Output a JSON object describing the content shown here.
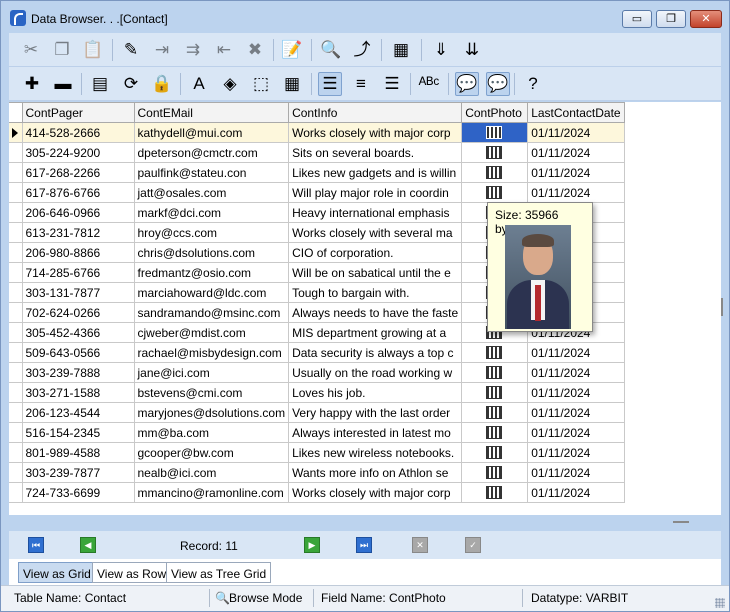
{
  "window": {
    "title": "Data Browser. . .[Contact]",
    "minimize_glyph": "▭",
    "restore_glyph": "❐",
    "close_glyph": "✕"
  },
  "toolbar_row1": [
    {
      "icon": "cut-icon",
      "glyph": "✂",
      "enabled": false
    },
    {
      "icon": "copy-icon",
      "glyph": "❐",
      "enabled": false
    },
    {
      "icon": "paste-icon",
      "glyph": "📋",
      "enabled": false
    },
    {
      "icon": "edit-pencil-icon",
      "glyph": "✎",
      "enabled": true
    },
    {
      "icon": "insert-row-icon",
      "glyph": "⇥",
      "enabled": false
    },
    {
      "icon": "append-row-icon",
      "glyph": "⇉",
      "enabled": false
    },
    {
      "icon": "delete-row-icon",
      "glyph": "⇤",
      "enabled": false
    },
    {
      "icon": "delete-x-icon",
      "glyph": "✖",
      "enabled": false
    },
    {
      "icon": "edit-document-icon",
      "glyph": "📝",
      "enabled": true
    },
    {
      "icon": "find-icon",
      "glyph": "🔍",
      "enabled": true
    },
    {
      "icon": "find-next-icon",
      "glyph": "⤴",
      "enabled": true
    },
    {
      "icon": "filter-icon",
      "glyph": "▦",
      "enabled": true
    },
    {
      "icon": "sort-ascending-icon",
      "glyph": "⇓",
      "enabled": true
    },
    {
      "icon": "sort-descending-icon",
      "glyph": "⇊",
      "enabled": true
    }
  ],
  "toolbar_row2": [
    {
      "icon": "add-record-icon",
      "glyph": "✚",
      "enabled": true
    },
    {
      "icon": "delete-record-icon",
      "glyph": "▬",
      "enabled": true
    },
    {
      "icon": "layout-icon",
      "glyph": "▤",
      "enabled": true
    },
    {
      "icon": "refresh-icon",
      "glyph": "⟳",
      "enabled": true
    },
    {
      "icon": "lock-icon",
      "glyph": "🔒",
      "enabled": true
    },
    {
      "icon": "font-icon",
      "glyph": "A",
      "enabled": true
    },
    {
      "icon": "fill-color-icon",
      "glyph": "◈",
      "enabled": true
    },
    {
      "icon": "fit-columns-icon",
      "glyph": "⬚",
      "enabled": true
    },
    {
      "icon": "grid-lines-icon",
      "glyph": "▦",
      "enabled": true
    },
    {
      "icon": "align-left-icon",
      "glyph": "☰",
      "enabled": true,
      "pressed": true
    },
    {
      "icon": "align-center-icon",
      "glyph": "≡",
      "enabled": true
    },
    {
      "icon": "align-right-icon",
      "glyph": "☰",
      "enabled": true
    },
    {
      "icon": "spell-check-icon",
      "glyph": "ᴬᴮᶜ",
      "enabled": true
    },
    {
      "icon": "show-memo-tips-icon",
      "glyph": "💬",
      "enabled": true,
      "pressed": true
    },
    {
      "icon": "show-image-tips-icon",
      "glyph": "💬",
      "enabled": true,
      "pressed": true
    },
    {
      "icon": "help-icon",
      "glyph": "?",
      "enabled": true
    }
  ],
  "grid": {
    "columns": [
      "ContPager",
      "ContEMail",
      "ContInfo",
      "ContPhoto",
      "LastContactDate"
    ],
    "rows": [
      {
        "pager": "414-528-2666",
        "email": "kathydell@mui.com",
        "info": "Works closely with major corp",
        "date": "01/11/2024",
        "current": true
      },
      {
        "pager": "305-224-9200",
        "email": "dpeterson@cmctr.com",
        "info": "Sits on several boards.",
        "date": "01/11/2024"
      },
      {
        "pager": "617-268-2266",
        "email": "paulfink@stateu.con",
        "info": "Likes new gadgets and is willin",
        "date": "01/11/2024"
      },
      {
        "pager": "617-876-6766",
        "email": "jatt@osales.com",
        "info": "Will play major role in coordin",
        "date": "01/11/2024"
      },
      {
        "pager": "206-646-0966",
        "email": "markf@dci.com",
        "info": "Heavy international emphasis",
        "date": "01/11/2024"
      },
      {
        "pager": "613-231-7812",
        "email": "hroy@ccs.com",
        "info": "Works closely with several ma",
        "date": "01/11/2024"
      },
      {
        "pager": "206-980-8866",
        "email": "chris@dsolutions.com",
        "info": "CIO of corporation.",
        "date": "01/11/2024"
      },
      {
        "pager": "714-285-6766",
        "email": "fredmantz@osio.com",
        "info": "Will be on sabatical until the e",
        "date": "01/11/2024"
      },
      {
        "pager": "303-131-7877",
        "email": "marciahoward@ldc.com",
        "info": "Tough to bargain with.",
        "date": "01/11/2024"
      },
      {
        "pager": "702-624-0266",
        "email": "sandramando@msinc.com",
        "info": "Always needs to have the faste",
        "date": "01/11/2024"
      },
      {
        "pager": "305-452-4366",
        "email": "cjweber@mdist.com",
        "info": "MIS department growing at a",
        "date": "01/11/2024"
      },
      {
        "pager": "509-643-0566",
        "email": "rachael@misbydesign.com",
        "info": "Data security is always a top c",
        "date": "01/11/2024"
      },
      {
        "pager": "303-239-7888",
        "email": "jane@ici.com",
        "info": "Usually on the road working w",
        "date": "01/11/2024"
      },
      {
        "pager": "303-271-1588",
        "email": "bstevens@cmi.com",
        "info": "Loves his job.",
        "date": "01/11/2024"
      },
      {
        "pager": "206-123-4544",
        "email": "maryjones@dsolutions.com",
        "info": "Very happy with the last order",
        "date": "01/11/2024"
      },
      {
        "pager": "516-154-2345",
        "email": "mm@ba.com",
        "info": "Always interested in latest mo",
        "date": "01/11/2024"
      },
      {
        "pager": "801-989-4588",
        "email": "gcooper@bw.com",
        "info": "Likes new wireless notebooks.",
        "date": "01/11/2024"
      },
      {
        "pager": "303-239-7877",
        "email": "nealb@ici.com",
        "info": "Wants more info on Athlon se",
        "date": "01/11/2024"
      },
      {
        "pager": "724-733-6699",
        "email": "mmancino@ramonline.com",
        "info": "Works closely with major corp",
        "date": "01/11/2024"
      }
    ]
  },
  "tooltip": {
    "text": "Size: 35966 bytes."
  },
  "navigator": {
    "record_label": "Record: 11",
    "first_glyph": "⏮",
    "prior_glyph": "◀",
    "next_glyph": "▶",
    "last_glyph": "⏭",
    "cancel_glyph": "✕",
    "post_glyph": "✓"
  },
  "view_tabs": [
    "View as Grid",
    "View as Row",
    "View as Tree Grid"
  ],
  "status": {
    "table": "Table Name: Contact",
    "mode": "Browse Mode",
    "field": "Field Name: ContPhoto",
    "datatype": "Datatype: VARBIT"
  }
}
